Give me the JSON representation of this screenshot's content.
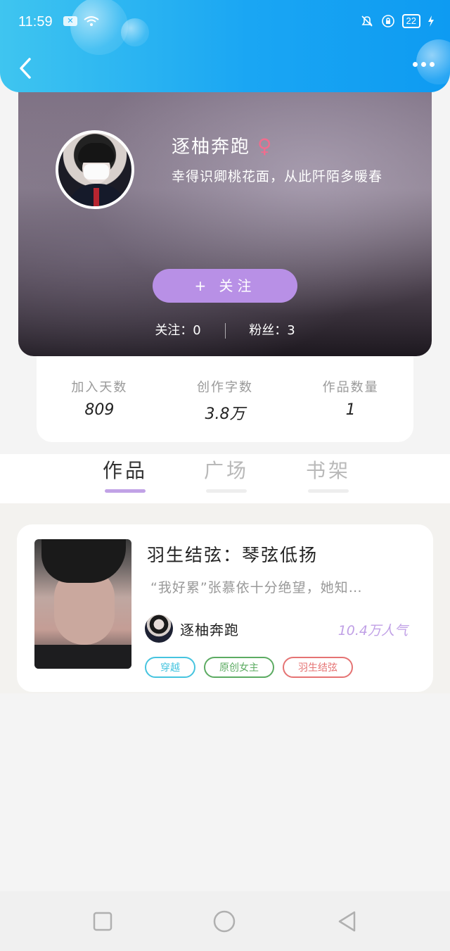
{
  "status_bar": {
    "time": "11:59",
    "notification_box": "✕",
    "battery": "22"
  },
  "profile": {
    "username": "逐柚奔跑",
    "gender_symbol": "♀",
    "bio": "幸得识卿桃花面，从此阡陌多暖春",
    "follow_button": "+ 关注",
    "following_label": "关注：0",
    "fans_label": "粉丝：3"
  },
  "stats": [
    {
      "label": "加入天数",
      "value": "809"
    },
    {
      "label": "创作字数",
      "value": "3.8万"
    },
    {
      "label": "作品数量",
      "value": "1"
    }
  ],
  "tabs": [
    {
      "label": "作品",
      "active": true
    },
    {
      "label": "广场",
      "active": false
    },
    {
      "label": "书架",
      "active": false
    }
  ],
  "work": {
    "title": "羽生结弦：琴弦低扬",
    "description": "“我好累”张慕依十分绝望，她知…",
    "author": "逐柚奔跑",
    "popularity": "10.4万人气",
    "tags": [
      "穿越",
      "原创女主",
      "羽生结弦"
    ]
  },
  "colors": {
    "header_blue": "#1aa6f3",
    "accent_purple": "#b890e6",
    "gender_pink": "#f06d8e"
  }
}
